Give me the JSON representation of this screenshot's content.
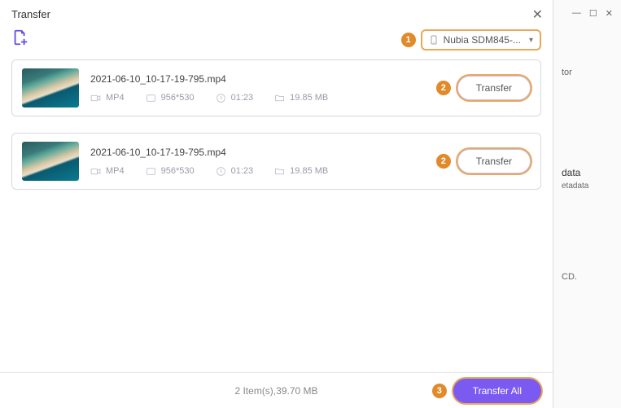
{
  "window_title": "Transfer",
  "callouts": {
    "one": "1",
    "two": "2",
    "three": "3"
  },
  "device": {
    "label": "Nubia SDM845-..."
  },
  "items": [
    {
      "filename": "2021-06-10_10-17-19-795.mp4",
      "format": "MP4",
      "resolution": "956*530",
      "duration": "01:23",
      "size": "19.85 MB",
      "transfer_label": "Transfer"
    },
    {
      "filename": "2021-06-10_10-17-19-795.mp4",
      "format": "MP4",
      "resolution": "956*530",
      "duration": "01:23",
      "size": "19.85 MB",
      "transfer_label": "Transfer"
    }
  ],
  "footer": {
    "summary": "2 Item(s),39.70 MB",
    "transfer_all_label": "Transfer All"
  },
  "background": {
    "text1": "tor",
    "text2": "data",
    "text3": "etadata",
    "text4": "CD."
  }
}
